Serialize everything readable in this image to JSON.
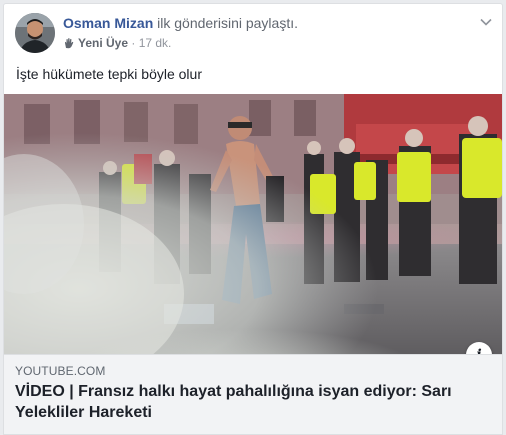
{
  "post": {
    "author_name": "Osman Mizan",
    "action_text": " ilk gönderisini paylaştı.",
    "badge_label": "Yeni Üye",
    "separator": " · ",
    "time": "17 dk.",
    "body_text": "İşte hükümete tepki böyle olur"
  },
  "icons": {
    "options": "chevron-down-icon",
    "new_member": "wave-hand-icon",
    "info": "info-icon"
  },
  "media": {
    "kind": "video-thumbnail",
    "info_label": "i"
  },
  "link": {
    "domain": "YOUTUBE.COM",
    "title": "VİDEO | Fransız halkı hayat pahalılığına isyan ediyor: Sarı Yelekliler Hareketi"
  },
  "colors": {
    "author": "#385898",
    "vest_yellow": "#d9e82b",
    "smoke": "#c8cccb"
  }
}
